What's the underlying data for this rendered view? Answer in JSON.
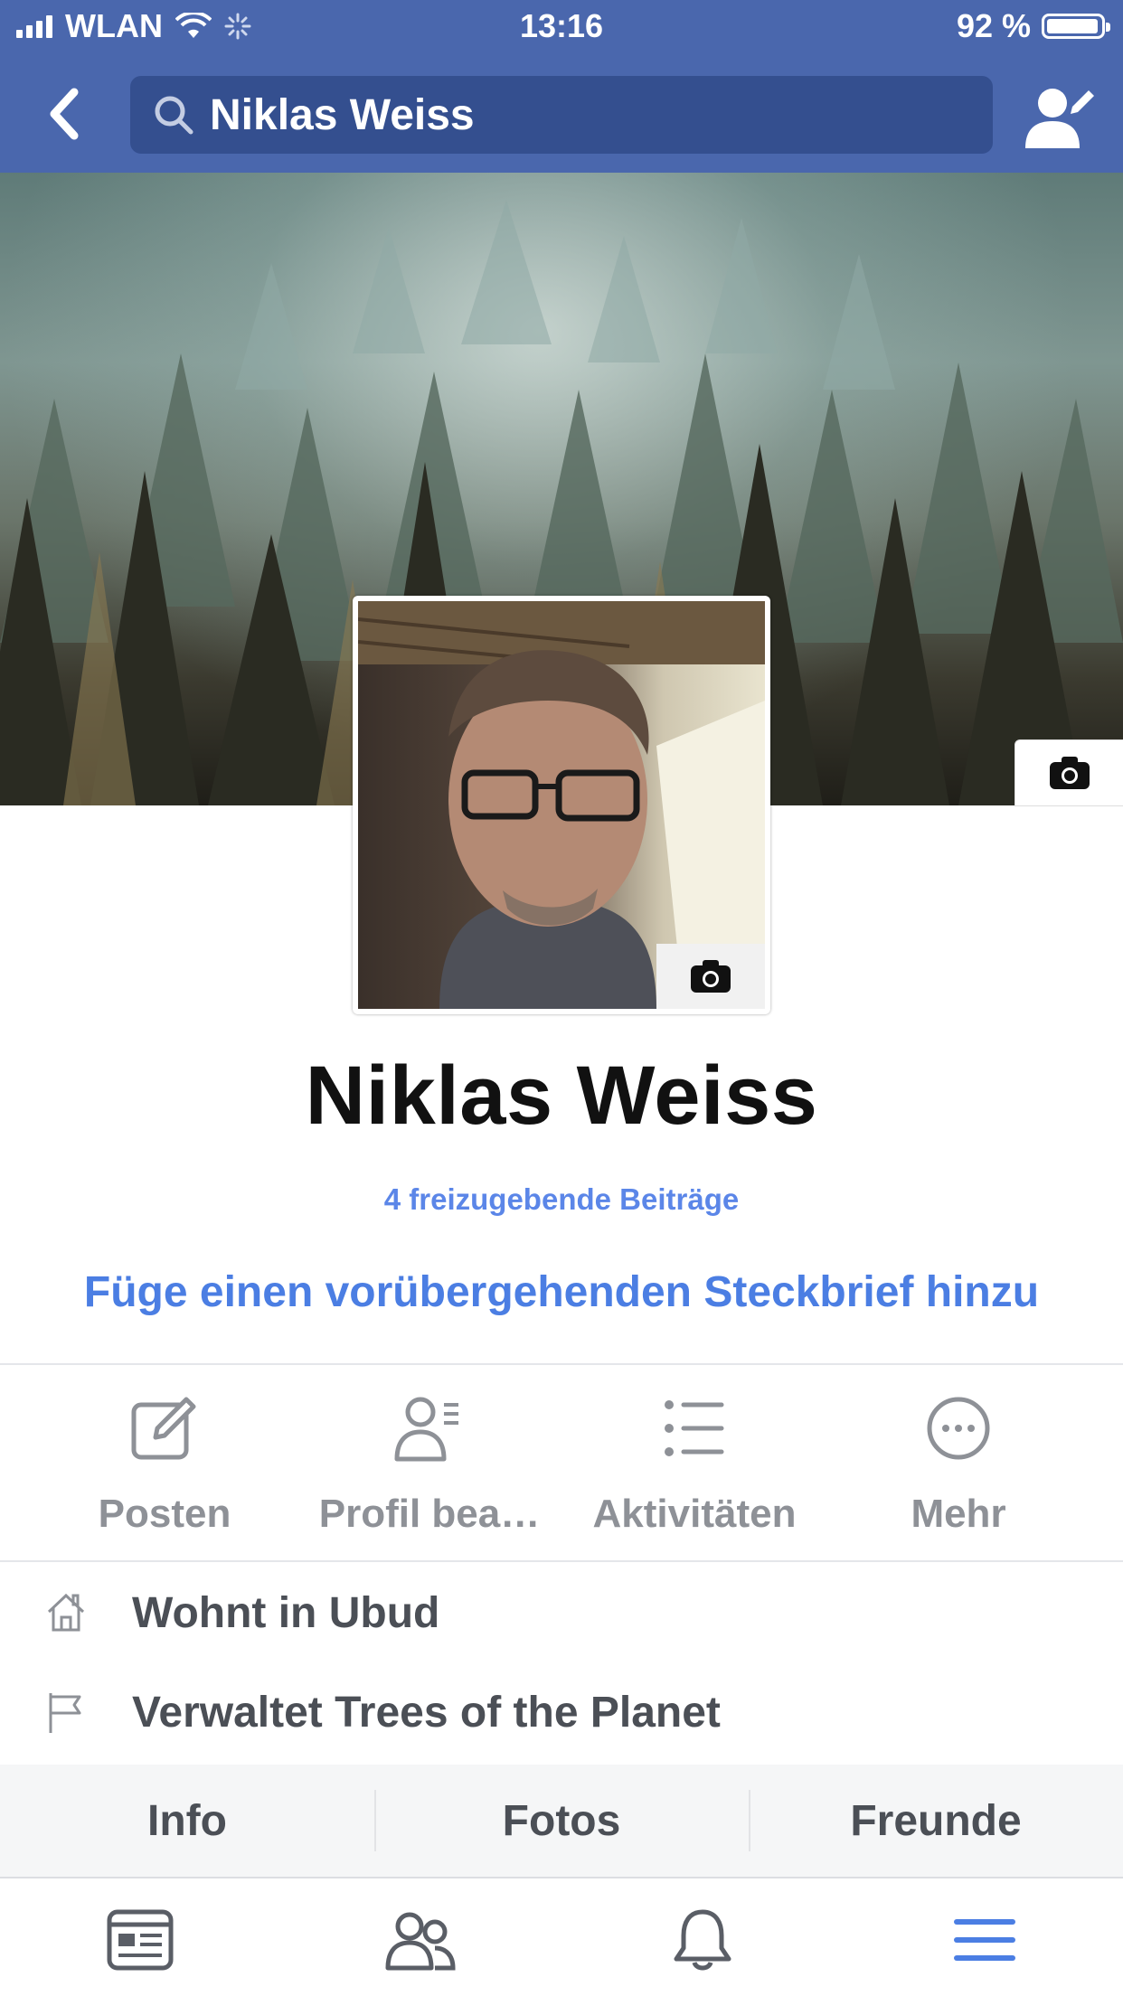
{
  "status_bar": {
    "carrier": "WLAN",
    "time": "13:16",
    "battery": "92 %",
    "battery_level": 0.92
  },
  "header": {
    "search_text": "Niklas Weiss"
  },
  "profile": {
    "name": "Niklas Weiss",
    "pending_posts": "4 freizugebende Beiträge",
    "add_bio": "Füge einen vorübergehenden Steckbrief hinzu"
  },
  "actions": [
    {
      "label": "Posten",
      "icon": "edit-icon"
    },
    {
      "label": "Profil bea…",
      "icon": "profile-edit-icon"
    },
    {
      "label": "Aktivitäten",
      "icon": "list-icon"
    },
    {
      "label": "Mehr",
      "icon": "more-icon"
    }
  ],
  "info": [
    {
      "text": "Wohnt in Ubud",
      "icon": "home-icon"
    },
    {
      "text": "Verwaltet Trees of the Planet",
      "icon": "flag-icon"
    }
  ],
  "tabs": [
    "Info",
    "Fotos",
    "Freunde"
  ],
  "bottom_nav": [
    "news-feed-icon",
    "friends-icon",
    "notifications-icon",
    "menu-icon"
  ],
  "colors": {
    "brand": "#4a67ad",
    "link": "#4b7ee3",
    "muted": "#8e9197"
  }
}
